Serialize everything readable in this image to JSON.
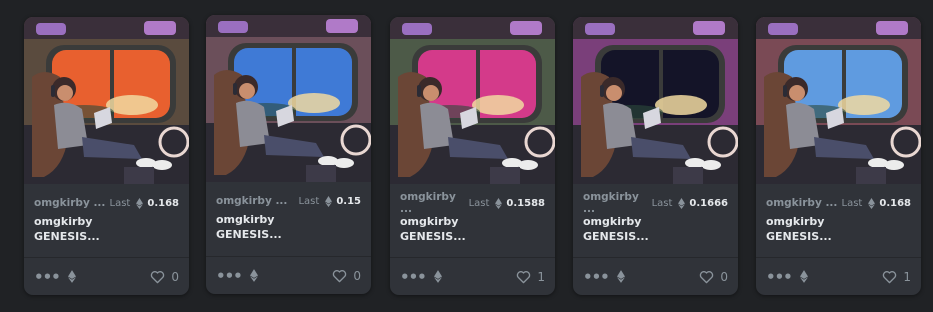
{
  "cards": [
    {
      "creator": "omgkirby ...",
      "last_label": "Last",
      "price": "0.168",
      "title_line1": "omgkirby",
      "title_line2": "GENESIS...",
      "likes": "0",
      "window_sky": "#e8602f",
      "interior": "#5a4b3e"
    },
    {
      "creator": "omgkirby ...",
      "last_label": "Last",
      "price": "0.15",
      "title_line1": "omgkirby",
      "title_line2": "GENESIS...",
      "likes": "0",
      "window_sky": "#3f7ad6",
      "interior": "#6b4f5a"
    },
    {
      "creator": "omgkirby ...",
      "last_label": "Last",
      "price": "0.1588",
      "title_line1": "omgkirby",
      "title_line2": "GENESIS...",
      "likes": "1",
      "window_sky": "#d43a8a",
      "interior": "#4d5a48"
    },
    {
      "creator": "omgkirby ...",
      "last_label": "Last",
      "price": "0.1666",
      "title_line1": "omgkirby",
      "title_line2": "GENESIS...",
      "likes": "0",
      "window_sky": "#141428",
      "interior": "#7a3f7a"
    },
    {
      "creator": "omgkirby ...",
      "last_label": "Last",
      "price": "0.168",
      "title_line1": "omgkirby",
      "title_line2": "GENESIS...",
      "likes": "1",
      "window_sky": "#5f9be0",
      "interior": "#7a4a55"
    }
  ]
}
